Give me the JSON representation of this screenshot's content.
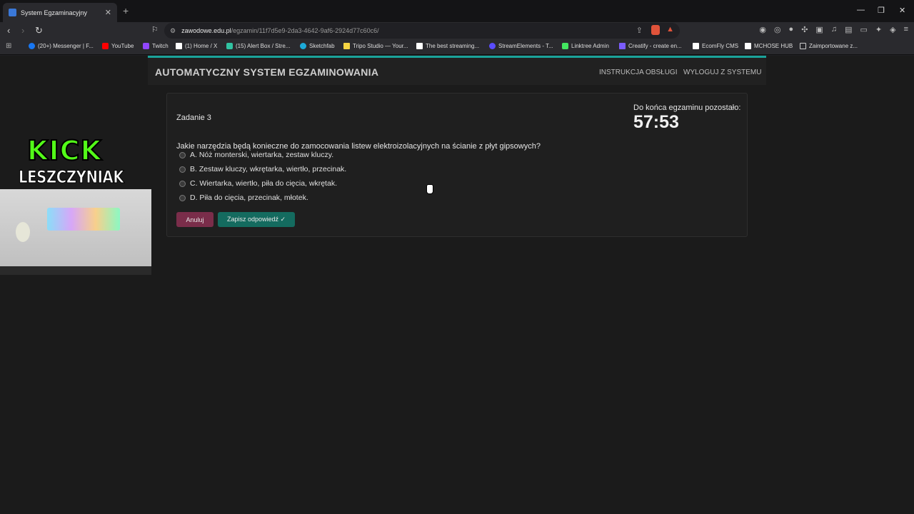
{
  "browser": {
    "tab_title": "System Egzaminacyjny",
    "tab_close": "✕",
    "new_tab": "+",
    "window_controls": [
      "—",
      "❐",
      "✕"
    ],
    "url_host": "zawodowe.edu.pl",
    "url_path": "/egzamin/11f7d5e9-2da3-4642-9af6-2924d77c60c6/",
    "bookmarks": [
      {
        "label": "(20+) Messenger | F...",
        "color": "#1877f2"
      },
      {
        "label": "YouTube",
        "color": "#ff0000"
      },
      {
        "label": "Twitch",
        "color": "#9146ff"
      },
      {
        "label": "(1) Home / X",
        "color": "#ffffff"
      },
      {
        "label": "(15) Alert Box / Stre...",
        "color": "#31c3a2"
      },
      {
        "label": "Sketchfab",
        "color": "#1caad9"
      },
      {
        "label": "Tripo Studio — Your...",
        "color": "#f5d442"
      },
      {
        "label": "The best streaming...",
        "color": "#ffffff"
      },
      {
        "label": "StreamElements - T...",
        "color": "#5a4cff"
      },
      {
        "label": "Linktree Admin",
        "color": "#43e660"
      },
      {
        "label": "Creatify - create en...",
        "color": "#7b5cff"
      },
      {
        "label": "EcomFly CMS",
        "color": "#ffffff"
      },
      {
        "label": "MCHOSE HUB",
        "color": "#ffffff"
      },
      {
        "label": "Zaimportowane z...",
        "color": "#cccccc"
      }
    ]
  },
  "app": {
    "title": "AUTOMATYCZNY SYSTEM EGZAMINOWANIA",
    "nav_instructions": "INSTRUKCJA OBSŁUGI",
    "nav_logout": "WYLOGUJ Z SYSTEMU"
  },
  "exam": {
    "question_number": "Zadanie 3",
    "timer_label": "Do końca egzaminu pozostało:",
    "timer_value": "57:53",
    "question": "Jakie narzędzia będą konieczne do zamocowania listew elektroizolacyjnych na ścianie z płyt gipsowych?",
    "options": [
      "A. Nóż monterski, wiertarka, zestaw kluczy.",
      "B. Zestaw kluczy, wkrętarka, wiertło, przecinak.",
      "C. Wiertarka, wiertło, piła do cięcia, wkrętak.",
      "D. Piła do cięcia, przecinak, młotek."
    ],
    "cancel_label": "Anuluj",
    "save_label": "Zapisz odpowiedź ✓"
  },
  "overlay": {
    "platform": "KICK",
    "streamer": "LESZCZYNIAK"
  }
}
